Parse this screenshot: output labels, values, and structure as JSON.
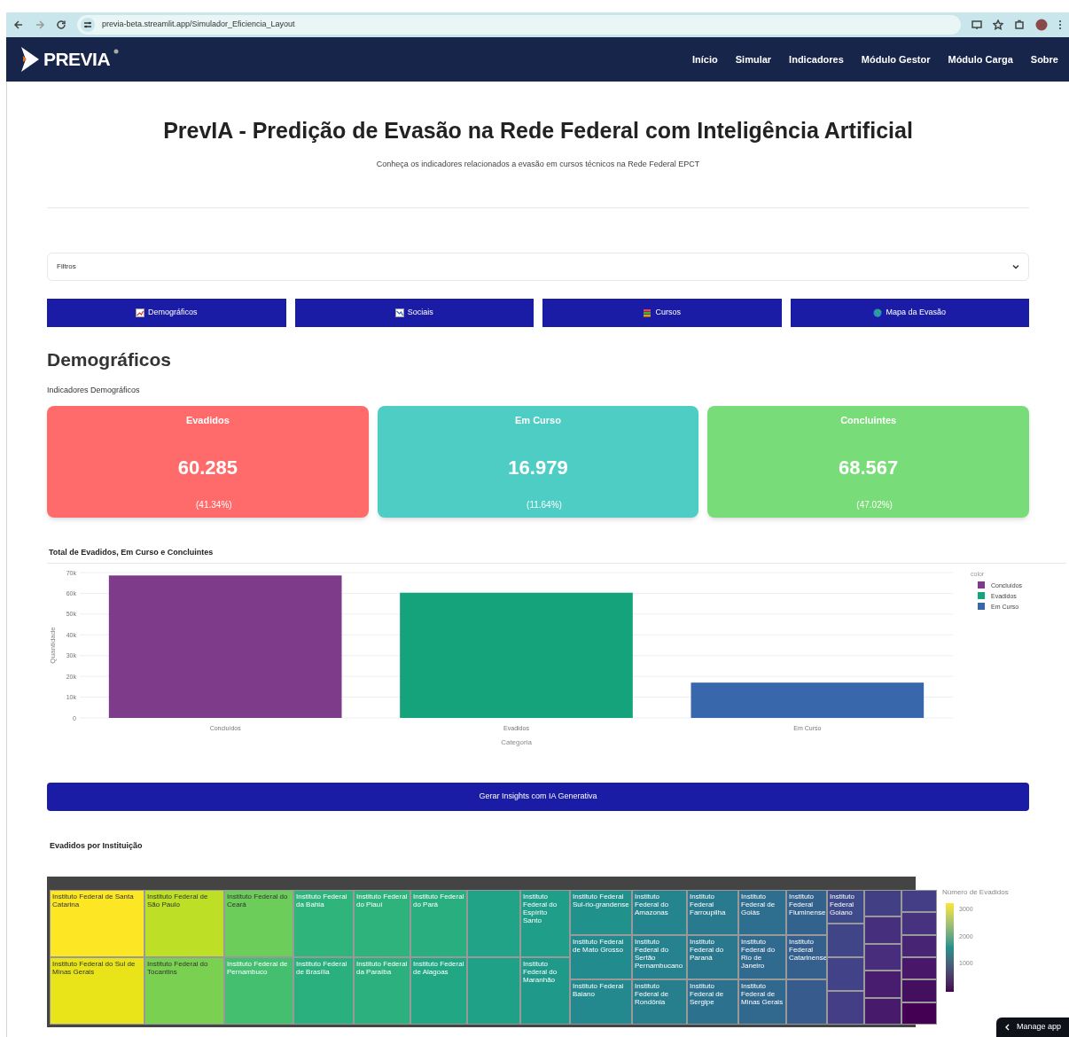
{
  "browser": {
    "url": "previa-beta.streamlit.app/Simulador_Eficiencia_Layout"
  },
  "navbar": {
    "logo": "PREVIA",
    "items": [
      "Início",
      "Simular",
      "Indicadores",
      "Módulo Gestor",
      "Módulo Carga",
      "Sobre"
    ]
  },
  "header": {
    "title": "PrevIA - Predição de Evasão na Rede Federal com Inteligência Artificial",
    "subtitle": "Conheça os indicadores relacionados a evasão em cursos técnicos na Rede Federal EPCT"
  },
  "filters": {
    "label": "Filtros",
    "expanded": false
  },
  "section_buttons": [
    {
      "label": "Demográficos",
      "kind": "chart"
    },
    {
      "label": "Sociais",
      "kind": "trend"
    },
    {
      "label": "Cursos",
      "kind": "books"
    },
    {
      "label": "Mapa da Evasão",
      "kind": "globe"
    }
  ],
  "section": {
    "title": "Demográficos",
    "subtitle": "Indicadores Demográficos"
  },
  "cards": [
    {
      "title": "Evadidos",
      "value": "60.285",
      "percent": "(41.34%)",
      "color": "#ff6b6b"
    },
    {
      "title": "Em Curso",
      "value": "16.979",
      "percent": "(11.64%)",
      "color": "#4ecdc4"
    },
    {
      "title": "Concluintes",
      "value": "68.567",
      "percent": "(47.02%)",
      "color": "#78dc78"
    }
  ],
  "bar_chart": {
    "legend_title": "color",
    "chart_data": {
      "type": "bar",
      "title": "Total de Evadidos, Em Curso e Concluintes",
      "xlabel": "Categoria",
      "ylabel": "Quantidade",
      "categories": [
        "Concluídos",
        "Evadidos",
        "Em Curso"
      ],
      "series": [
        {
          "name": "Concluídos",
          "color": "#7e3b8a",
          "values": [
            68600,
            null,
            null
          ]
        },
        {
          "name": "Evadidos",
          "color": "#14a37a",
          "values": [
            null,
            60300,
            null
          ]
        },
        {
          "name": "Em Curso",
          "color": "#3868ab",
          "values": [
            null,
            null,
            17000
          ]
        }
      ],
      "grid": true,
      "legend": true,
      "ylim": [
        0,
        70000
      ],
      "yticks": [
        {
          "value": 0,
          "label": "0"
        },
        {
          "value": 10000,
          "label": "10k"
        },
        {
          "value": 20000,
          "label": "20k"
        },
        {
          "value": 30000,
          "label": "30k"
        },
        {
          "value": 40000,
          "label": "40k"
        },
        {
          "value": 50000,
          "label": "50k"
        },
        {
          "value": 60000,
          "label": "60k"
        },
        {
          "value": 70000,
          "label": "70k"
        }
      ],
      "orientation": "vertical"
    }
  },
  "insights_button": "Gerar Insights com IA Generativa",
  "treemap": {
    "title": "Evadidos por Instituição",
    "colorbar": {
      "title": "Número de Evadidos",
      "ticks": [
        "3000",
        "2000",
        "1000"
      ]
    },
    "columns": [
      {
        "tiles": [
          {
            "label": "Instituto Federal de Santa Catarina",
            "color": "#fde725"
          },
          {
            "label": "Instituto Federal do Sul de Minas Gerais",
            "color": "#e8e419"
          }
        ]
      },
      {
        "tiles": [
          {
            "label": "Instituto Federal de São Paulo",
            "color": "#bddf26"
          },
          {
            "label": "Instituto Federal do Tocantins",
            "color": "#7ad151"
          }
        ]
      },
      {
        "tiles": [
          {
            "label": "Instituto Federal do Ceará",
            "color": "#6ccd5a"
          },
          {
            "label": "Instituto Federal de Pernambuco",
            "color": "#44bf70"
          }
        ]
      },
      {
        "tiles": [
          {
            "label": "Instituto Federal da Bahia",
            "color": "#2fb47c"
          },
          {
            "label": "Instituto Federal de Brasília",
            "color": "#2ab07f"
          }
        ]
      },
      {
        "tiles": [
          {
            "label": "Instituto Federal do Piauí",
            "color": "#2eb37c"
          },
          {
            "label": "Instituto Federal da Paraíba",
            "color": "#2cb17e"
          }
        ]
      },
      {
        "tiles": [
          {
            "label": "Instituto Federal do Pará",
            "color": "#29af7f"
          },
          {
            "label": "Instituto Federal de Alagoas",
            "color": "#22a785"
          }
        ]
      },
      {
        "tiles": [
          {
            "color": "#20a386"
          },
          {
            "color": "#1fa187"
          }
        ]
      },
      {
        "tiles": [
          {
            "label": "Instituto Federal do Espírito Santo",
            "color": "#1f9e89"
          },
          {
            "label": "Instituto Federal do Maranhão",
            "color": "#1f9a8a"
          }
        ]
      },
      {
        "tiles": [
          {
            "label": "Instituto Federal Sul-rio-grandense",
            "color": "#21918c"
          },
          {
            "label": "Instituto Federal de Mato Grosso",
            "color": "#228b8d"
          },
          {
            "label": "Instituto Federal Baiano",
            "color": "#23898e"
          }
        ]
      },
      {
        "tiles": [
          {
            "label": "Instituto Federal do Amazonas",
            "color": "#25858e"
          },
          {
            "label": "Instituto Federal do Sertão Pernambucano",
            "color": "#26828e"
          },
          {
            "label": "Instituto Federal de Rondônia",
            "color": "#277f8e"
          }
        ]
      },
      {
        "tiles": [
          {
            "label": "Instituto Federal Farroupilha",
            "color": "#297a8e"
          },
          {
            "label": "Instituto Federal do Paraná",
            "color": "#2a788e"
          },
          {
            "label": "Instituto Federal de Sergipe",
            "color": "#2c728e"
          }
        ]
      },
      {
        "tiles": [
          {
            "label": "Instituto Federal de Goiás",
            "color": "#2e6e8e"
          },
          {
            "label": "Instituto Federal do Rio de Janeiro",
            "color": "#306a8e"
          },
          {
            "label": "Instituto Federal de Minas Gerais",
            "color": "#31688e"
          }
        ]
      },
      {
        "tiles": [
          {
            "label": "Instituto Federal Fluminense",
            "color": "#33638d"
          },
          {
            "label": "Instituto Federal Catarinense",
            "color": "#355f8d"
          },
          {
            "color": "#375b8d"
          }
        ]
      },
      {
        "tiles": [
          {
            "label": "Instituto Federal Goiano",
            "color": "#3e4a89"
          },
          {
            "color": "#404588"
          },
          {
            "color": "#414287"
          },
          {
            "color": "#433e85"
          }
        ]
      },
      {
        "tiles": [
          {
            "color": "#423f85"
          },
          {
            "color": "#46307e"
          },
          {
            "color": "#472d7b"
          },
          {
            "color": "#481d6f"
          },
          {
            "color": "#481a6c"
          }
        ]
      },
      {
        "tiles": [
          {
            "color": "#433e85"
          },
          {
            "color": "#46327e"
          },
          {
            "color": "#482475"
          },
          {
            "color": "#481769"
          },
          {
            "color": "#440f5e"
          },
          {
            "color": "#440154"
          }
        ]
      }
    ]
  },
  "manage_app": "Manage app"
}
